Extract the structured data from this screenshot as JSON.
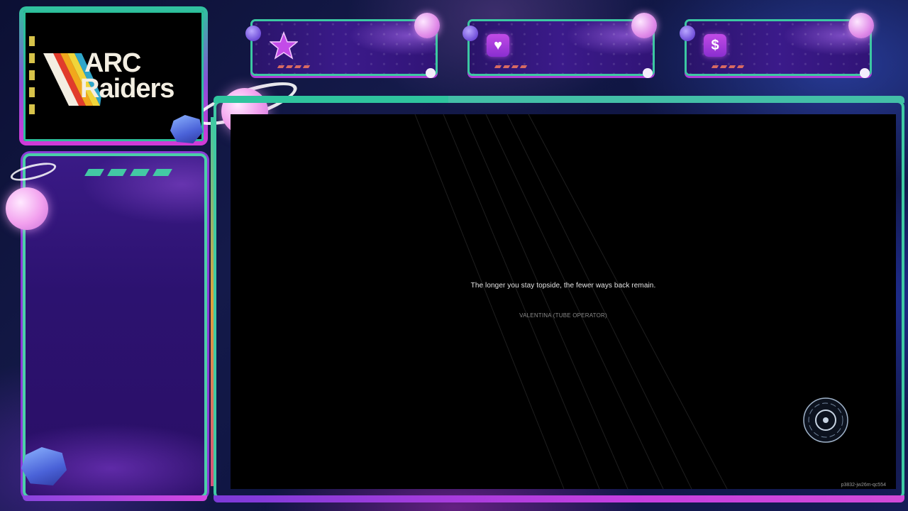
{
  "logo": {
    "line1": "ARC",
    "line2": "Raiders"
  },
  "alerts": [
    {
      "icon": "star-icon",
      "glyph": ""
    },
    {
      "icon": "heart-icon",
      "glyph": "♥"
    },
    {
      "icon": "dollar-icon",
      "glyph": "$"
    }
  ],
  "loading_screen": {
    "quote": "The longer you stay topside, the fewer ways back remain.",
    "attribution": "VALENTINA (TUBE OPERATOR)",
    "build_id": "p3832-jw26m-qc554"
  },
  "colors": {
    "frame_teal": "#3fc9a4",
    "frame_purple": "#8c3bd6",
    "frame_magenta": "#d446e0",
    "planet_pink": "#f2a0ee"
  }
}
